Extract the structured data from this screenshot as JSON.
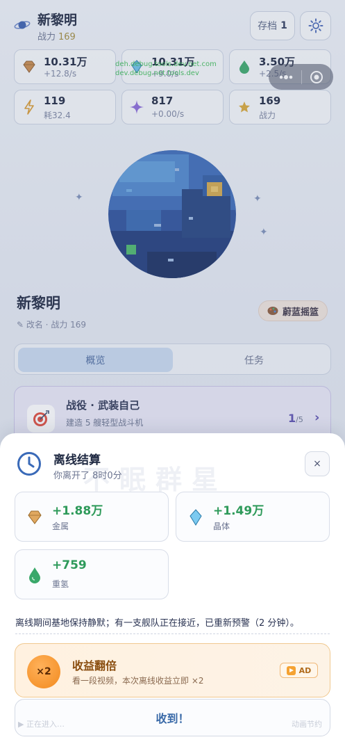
{
  "header": {
    "title": "新黎明",
    "power_label": "战力",
    "power_value": "169",
    "save_label": "存档",
    "save_slot": "1"
  },
  "resources": [
    {
      "value": "10.31万",
      "sub": "+12.8/s",
      "icon": "diamond-icon",
      "color": "#c98a4b"
    },
    {
      "value": "10.31万",
      "sub": "+9.0/s",
      "icon": "crystal-icon",
      "color": "#4aa6d8"
    },
    {
      "value": "3.50万",
      "sub": "+2.5/s",
      "icon": "drop-icon",
      "color": "#3aa86a"
    },
    {
      "value": "119",
      "sub": "耗32.4",
      "icon": "lightning-icon",
      "color": "#e0a030"
    },
    {
      "value": "817",
      "sub": "+0.00/s",
      "icon": "sparkle-icon",
      "color": "#8a6ad8"
    },
    {
      "value": "169",
      "sub": "战力",
      "icon": "star-icon",
      "color": "#d8a838"
    }
  ],
  "overlay_text": [
    "deh.debug.tools.dev.net.com",
    "dev.debug.net.tools.dev"
  ],
  "planet": {
    "name": "新黎明",
    "rename_label": "✎ 改名 · 战力 169",
    "cradle_label": "蔚蓝摇篮"
  },
  "tabs": [
    {
      "label": "概览"
    },
    {
      "label": "任务"
    }
  ],
  "campaign": {
    "title": "战役 · 武装自己",
    "desc": "建造 5 艘轻型战斗机",
    "progress": "1",
    "total": "/5",
    "chevron": "›"
  },
  "modal": {
    "watermark": "不眠群星",
    "title": "离线结算",
    "subtitle": "你离开了 8时0分",
    "close": "×",
    "gains": [
      {
        "value": "+1.88万",
        "name": "金属",
        "icon": "diamond-icon",
        "color": "#c98a4b"
      },
      {
        "value": "+1.49万",
        "name": "晶体",
        "icon": "crystal-icon",
        "color": "#4aa6d8"
      },
      {
        "value": "+759",
        "name": "重氢",
        "icon": "drop-icon",
        "color": "#3aa86a"
      }
    ],
    "notice": "离线期间基地保持静默；有一支舰队正在接近，已重新预警（2 分钟）。",
    "double": {
      "badge": "×2",
      "title": "收益翻倍",
      "desc": "看一段视频，本次离线收益立即 ×2",
      "ad": "AD"
    },
    "collect_label": "收到！",
    "faint_left": "▶ 正在进入…",
    "faint_right": "动画节约"
  },
  "colors": {
    "accent_blue": "#3a6aa8",
    "gain_green": "#2e9a5a",
    "campaign_purple": "#5b4fb0",
    "double_orange": "#f28a1e"
  }
}
